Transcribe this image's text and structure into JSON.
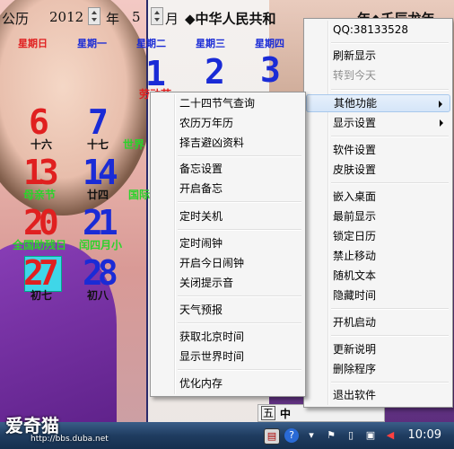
{
  "header": {
    "calendar_type": "公历",
    "year": "2012",
    "year_unit": "年",
    "month": "5",
    "month_unit": "月",
    "title_fragment": "◆中华人民共和",
    "title_tail": "年◆壬辰龙年"
  },
  "weekdays": [
    "星期日",
    "星期一",
    "星期二",
    "星期三",
    "星期四"
  ],
  "weekday_colors": [
    "#e02020",
    "#1a2bd6",
    "#1a2bd6",
    "#1a2bd6",
    "#1a2bd6"
  ],
  "days": [
    {
      "num": "1",
      "lunar": "",
      "color": "#1a2bd6"
    },
    {
      "num": "2",
      "lunar": "",
      "color": "#1a2bd6"
    },
    {
      "num": "3",
      "lunar": "",
      "color": "#1a2bd6"
    },
    {
      "num": "6",
      "lunar": "十六",
      "color": "#e02020"
    },
    {
      "num": "7",
      "lunar": "十七",
      "color": "#1a2bd6"
    },
    {
      "num": "13",
      "lunar": "",
      "color": "#e02020"
    },
    {
      "num": "14",
      "lunar": "廿四",
      "color": "#1a2bd6"
    },
    {
      "num": "20",
      "lunar": "",
      "color": "#e02020"
    },
    {
      "num": "21",
      "lunar": "",
      "color": "#1a2bd6"
    },
    {
      "num": "27",
      "lunar": "初七",
      "color": "#e02020"
    },
    {
      "num": "28",
      "lunar": "初八",
      "color": "#1a2bd6"
    }
  ],
  "festivals": {
    "labor_day": "劳动节",
    "world": "世界",
    "mothers_day": "母亲节",
    "national": "国际",
    "disabled_day": "全国助残日",
    "lunar_month": "闰四月小"
  },
  "menu_main": {
    "qq": "QQ:38133528",
    "refresh": "刷新显示",
    "goto_today": "转到今天",
    "other_functions": "其他功能",
    "display_settings": "显示设置",
    "software_settings": "软件设置",
    "skin_settings": "皮肤设置",
    "embed_desktop": "嵌入桌面",
    "topmost": "最前显示",
    "lock_calendar": "锁定日历",
    "no_move": "禁止移动",
    "random_text": "随机文本",
    "hide_time": "隐藏时间",
    "autostart": "开机启动",
    "update_notes": "更新说明",
    "uninstall": "删除程序",
    "exit": "退出软件"
  },
  "menu_sub": {
    "solar_terms": "二十四节气查询",
    "perpetual": "农历万年历",
    "auspicious": "择吉避凶资料",
    "memo_settings": "备忘设置",
    "open_memo": "开启备忘",
    "timed_shutdown": "定时关机",
    "timed_alarm": "定时闹钟",
    "today_alarm": "开启今日闹钟",
    "close_sound": "关闭提示音",
    "weather": "天气预报",
    "beijing_time": "获取北京时间",
    "world_time": "显示世界时间",
    "optimize_memory": "优化内存"
  },
  "taskbar": {
    "clock": "10:09",
    "ime_label": "五",
    "ime_mode": "中",
    "watermark": "爱奇猫",
    "watermark_url": "http://bbs.duba.net"
  }
}
